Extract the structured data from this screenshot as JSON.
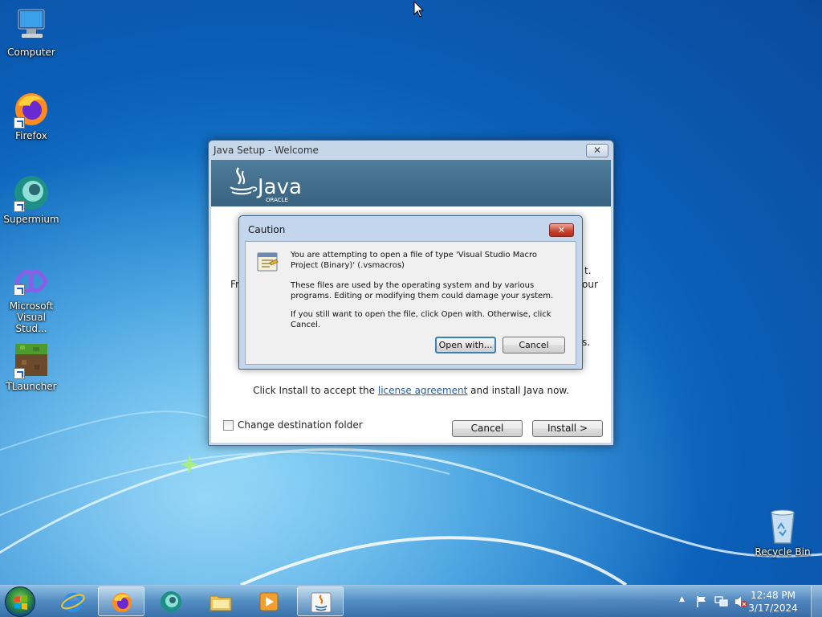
{
  "desktop": {
    "icons": [
      {
        "label": "Computer"
      },
      {
        "label": "Firefox"
      },
      {
        "label": "Supermium"
      },
      {
        "label": "Microsoft Visual Stud..."
      },
      {
        "label": "TLauncher"
      },
      {
        "label": "Recycle Bin"
      }
    ]
  },
  "java_setup": {
    "title": "Java Setup - Welcome",
    "logo_text": "Java",
    "logo_sub": "ORACLE",
    "body_fragments": [
      "t.",
      "Fr",
      "our",
      "s."
    ],
    "install_prefix": "Click Install to accept the ",
    "install_link": "license agreement",
    "install_suffix": " and install Java now.",
    "change_folder_label": "Change destination folder",
    "cancel_label": "Cancel",
    "install_label": "Install >"
  },
  "caution": {
    "title": "Caution",
    "close_glyph": "✕",
    "message1": "You are attempting to open a file of type 'Visual Studio Macro Project (Binary)' (.vsmacros)",
    "message2": "These files are used by the operating system and by various programs. Editing or modifying them could damage your system.",
    "message3": "If you still want to open the file, click Open with. Otherwise, click Cancel.",
    "open_with_label": "Open with...",
    "cancel_label": "Cancel"
  },
  "taskbar": {
    "time": "12:48 PM",
    "date": "3/17/2024",
    "tray_expand": "▲"
  }
}
